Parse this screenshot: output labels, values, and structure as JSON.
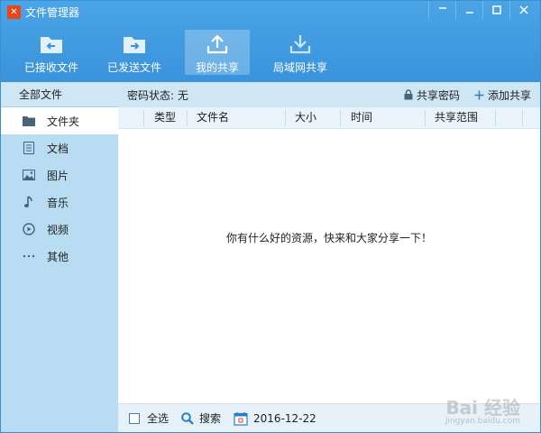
{
  "window": {
    "title": "文件管理器",
    "logo_glyph": "✕",
    "accent_color": "#3a93db"
  },
  "toolbar": {
    "items": [
      {
        "label": "已接收文件",
        "icon": "folder-receive-icon"
      },
      {
        "label": "已发送文件",
        "icon": "folder-send-icon"
      },
      {
        "label": "我的共享",
        "icon": "upload-share-icon",
        "active": true
      },
      {
        "label": "局域网共享",
        "icon": "download-lan-icon"
      }
    ]
  },
  "sidebar": {
    "header": "全部文件",
    "items": [
      {
        "label": "文件夹",
        "icon": "folder-icon",
        "active": true
      },
      {
        "label": "文档",
        "icon": "document-icon"
      },
      {
        "label": "图片",
        "icon": "image-icon"
      },
      {
        "label": "音乐",
        "icon": "music-icon"
      },
      {
        "label": "视频",
        "icon": "video-icon"
      },
      {
        "label": "其他",
        "icon": "more-icon"
      }
    ]
  },
  "main": {
    "password_status": "密码状态: 无",
    "share_password_label": "共享密码",
    "add_share_label": "添加共享",
    "columns": [
      "类型",
      "文件名",
      "大小",
      "时间",
      "共享范围"
    ],
    "empty_message": "你有什么好的资源，快来和大家分享一下！"
  },
  "footer": {
    "select_all_label": "全选",
    "search_label": "搜索",
    "date": "2016-12-22"
  },
  "watermark": {
    "logo_text": "Bai 经验",
    "url_text": "jingyan.baidu.com"
  }
}
